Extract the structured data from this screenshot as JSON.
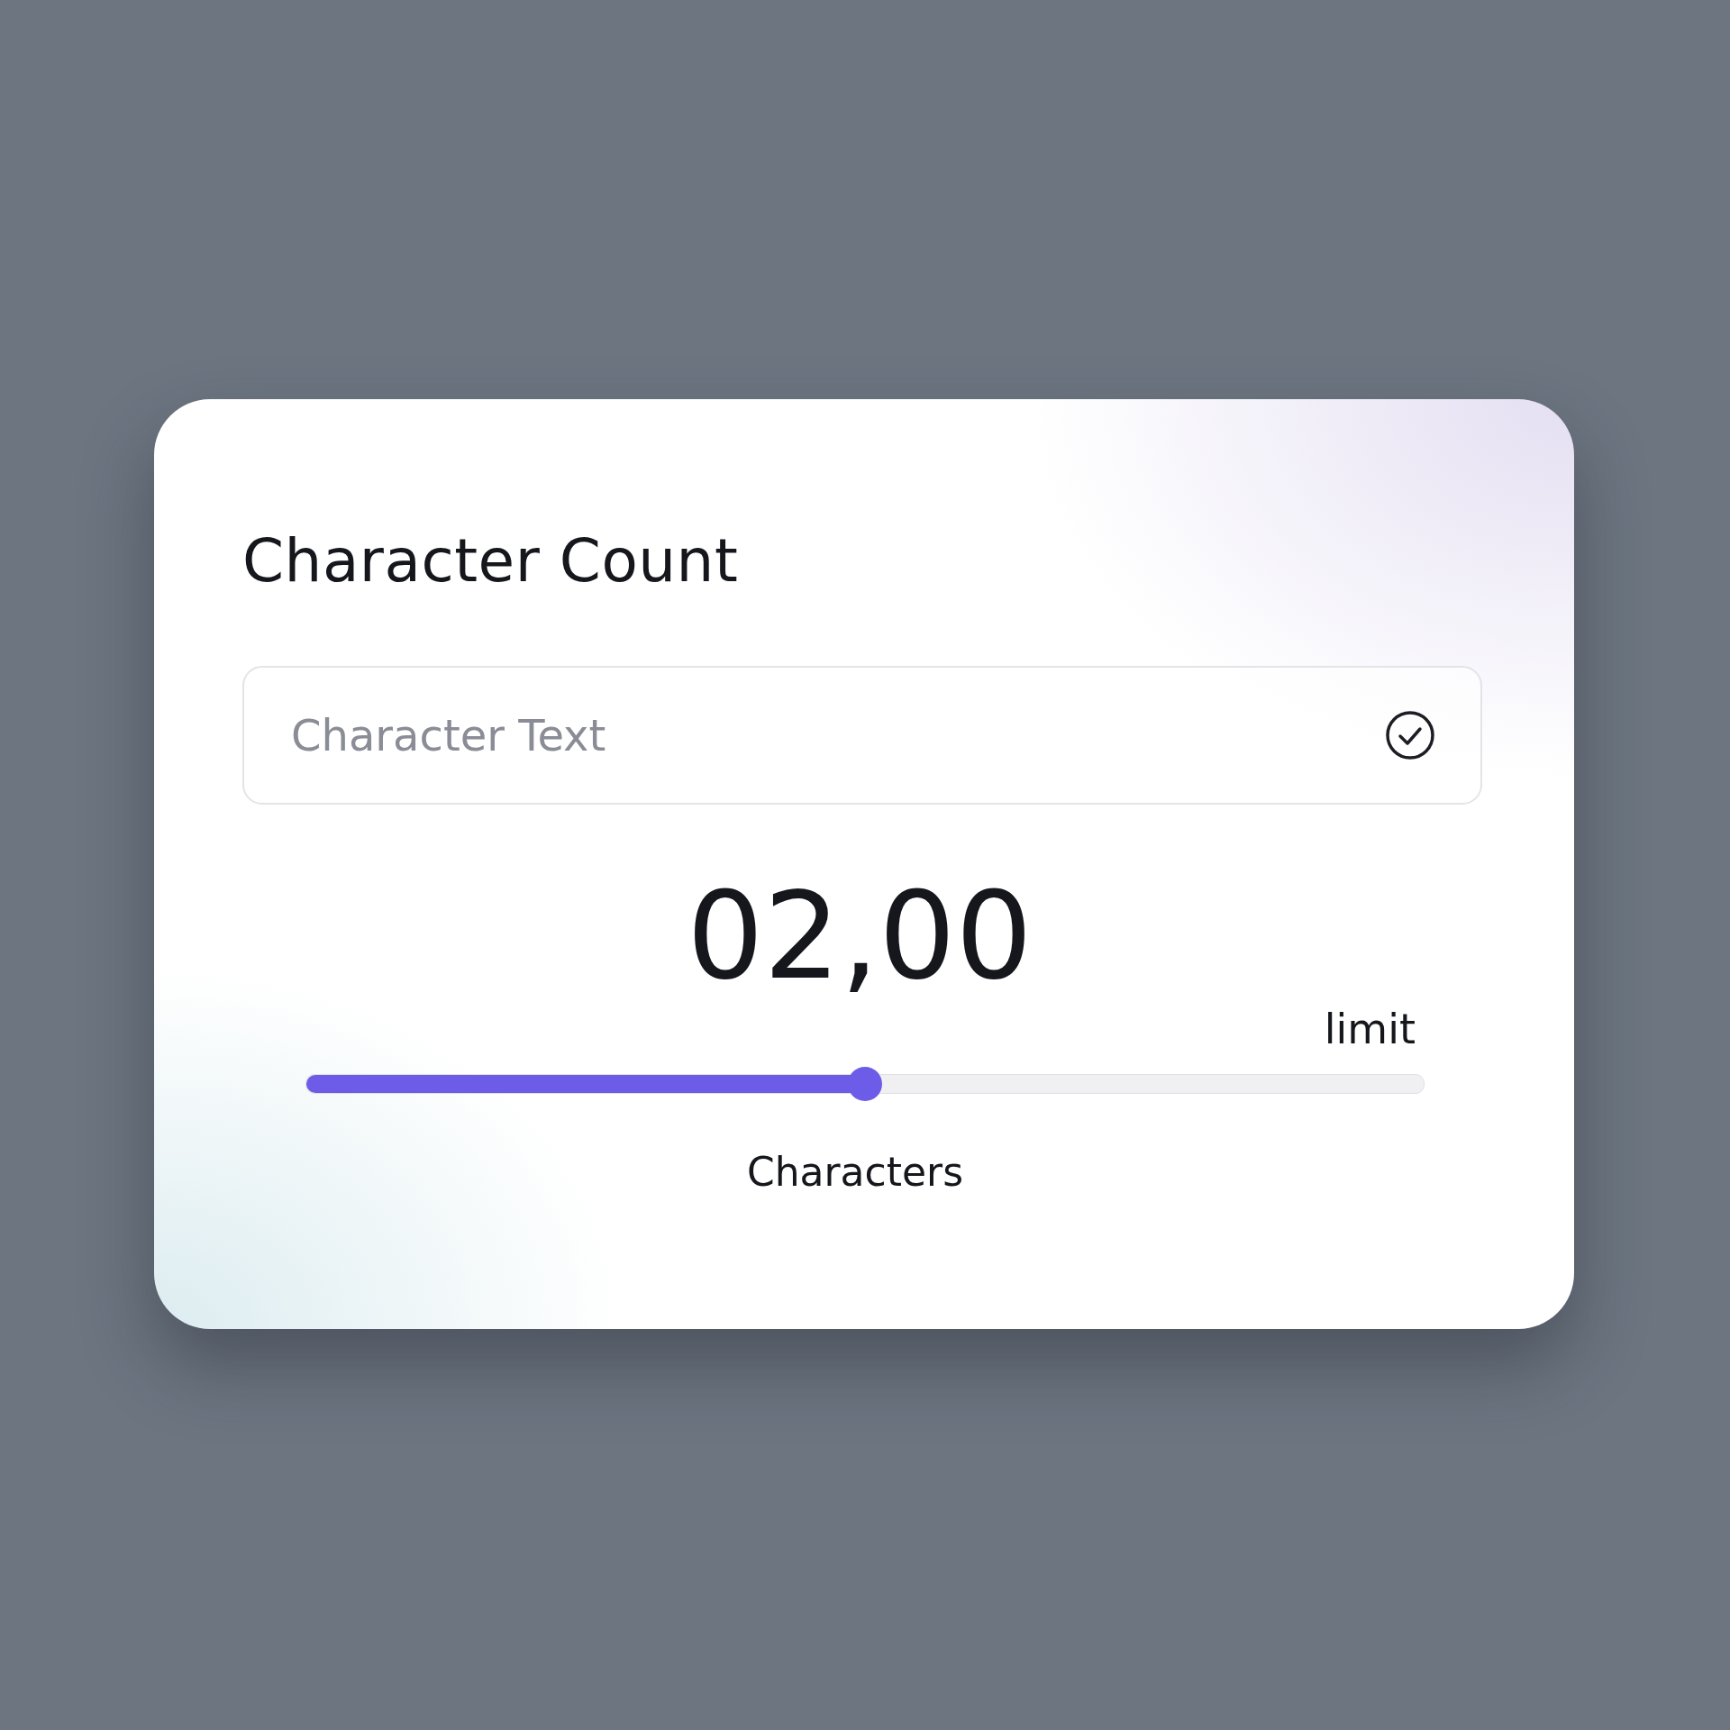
{
  "card": {
    "title": "Character Count"
  },
  "input": {
    "placeholder": "Character Text",
    "valid": true
  },
  "count": {
    "value": "02,00"
  },
  "slider": {
    "label": "limit",
    "level": 0.5
  },
  "caption": "Characters"
}
